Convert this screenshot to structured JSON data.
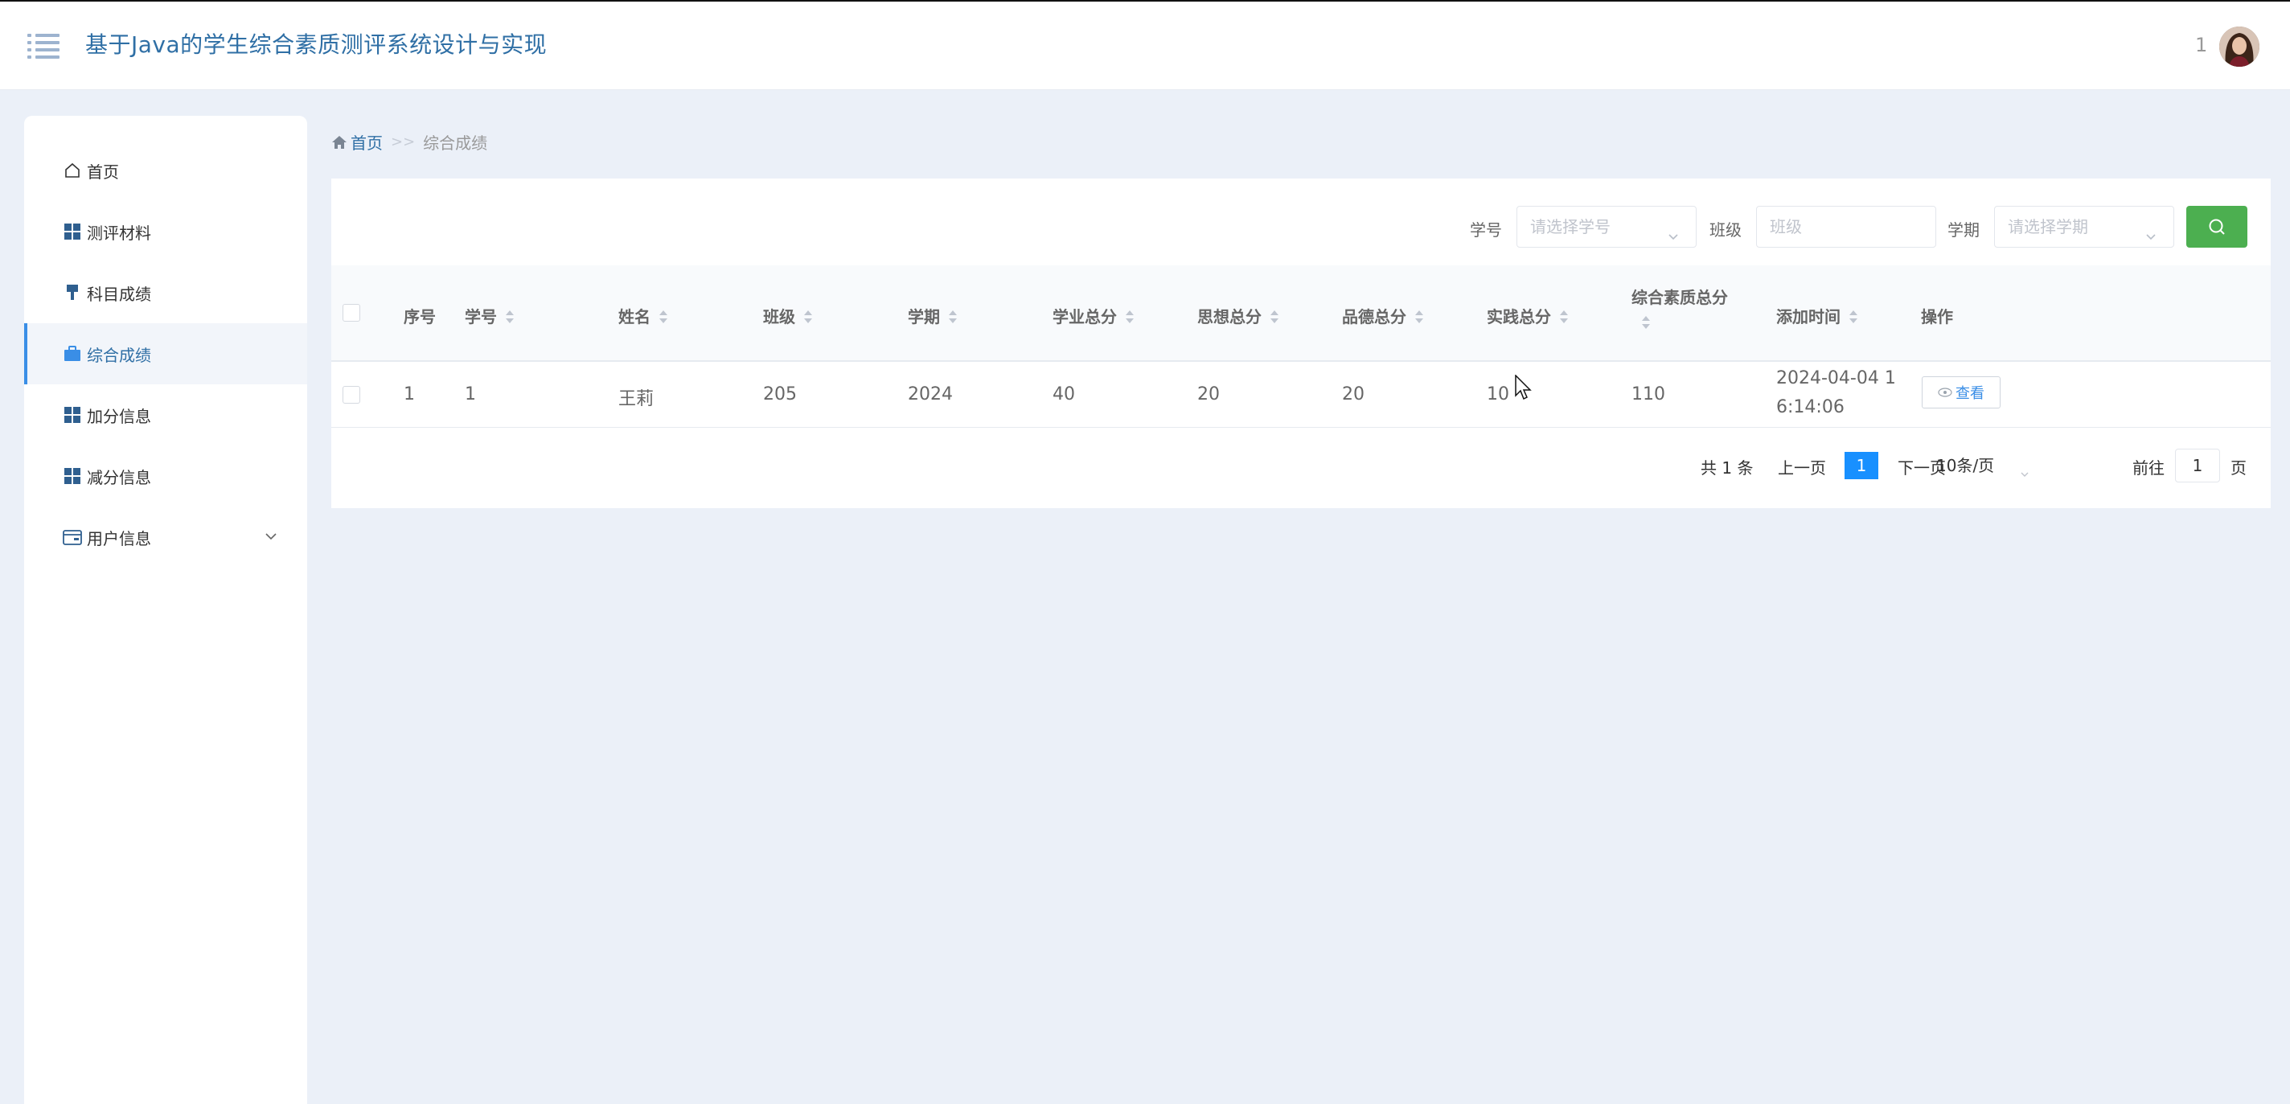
{
  "header": {
    "title": "基于Java的学生综合素质测评系统设计与实现",
    "user_name": "1"
  },
  "sidebar": {
    "items": [
      {
        "label": "首页",
        "icon": "home-icon"
      },
      {
        "label": "测评材料",
        "icon": "grid-icon"
      },
      {
        "label": "科目成绩",
        "icon": "brush-icon"
      },
      {
        "label": "综合成绩",
        "icon": "briefcase-icon",
        "active": true
      },
      {
        "label": "加分信息",
        "icon": "grid-icon"
      },
      {
        "label": "减分信息",
        "icon": "grid-icon"
      },
      {
        "label": "用户信息",
        "icon": "card-icon",
        "has_submenu": true
      }
    ]
  },
  "breadcrumb": {
    "home": "首页",
    "separator": ">>",
    "current": "综合成绩"
  },
  "filters": {
    "student_id_label": "学号",
    "student_id_placeholder": "请选择学号",
    "class_label": "班级",
    "class_placeholder": "班级",
    "term_label": "学期",
    "term_placeholder": "请选择学期"
  },
  "table": {
    "headers": {
      "index": "序号",
      "student_id": "学号",
      "name": "姓名",
      "class": "班级",
      "term": "学期",
      "academic": "学业总分",
      "ideology": "思想总分",
      "morality": "品德总分",
      "practice": "实践总分",
      "overall": "综合素质总分",
      "added": "添加时间",
      "actions": "操作"
    },
    "rows": [
      {
        "index": "1",
        "student_id": "1",
        "name": "王莉",
        "class": "205",
        "term": "2024",
        "academic": "40",
        "ideology": "20",
        "morality": "20",
        "practice": "10",
        "overall": "110",
        "added_line1": "2024-04-04 1",
        "added_line2": "6:14:06",
        "view_label": "查看"
      }
    ]
  },
  "pagination": {
    "total": "共 1 条",
    "prev": "上一页",
    "current": "1",
    "next": "下一页",
    "page_size": "10条/页",
    "goto_label": "前往",
    "goto_value": "1",
    "page_unit": "页"
  },
  "colors": {
    "accent": "#2f6fa5",
    "active_page": "#1890ff",
    "search_button": "#4caf50",
    "background": "#ebf0f8"
  }
}
